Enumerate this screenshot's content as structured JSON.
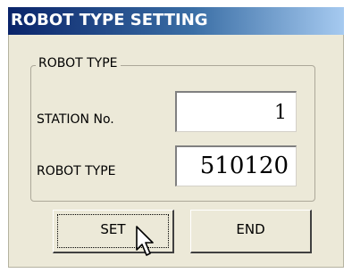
{
  "window": {
    "title": "ROBOT TYPE SETTING"
  },
  "group": {
    "label": "ROBOT TYPE"
  },
  "fields": {
    "station_label": "STATION No.",
    "station_value": "1",
    "robot_type_label": "ROBOT TYPE",
    "robot_type_value": "510120"
  },
  "buttons": {
    "set_label": "SET",
    "end_label": "END"
  },
  "icons": {
    "cursor": "mouse-pointer-icon"
  },
  "colors": {
    "title_gradient_start": "#0a246a",
    "title_gradient_end": "#a6caf0",
    "face": "#ece9d8"
  }
}
